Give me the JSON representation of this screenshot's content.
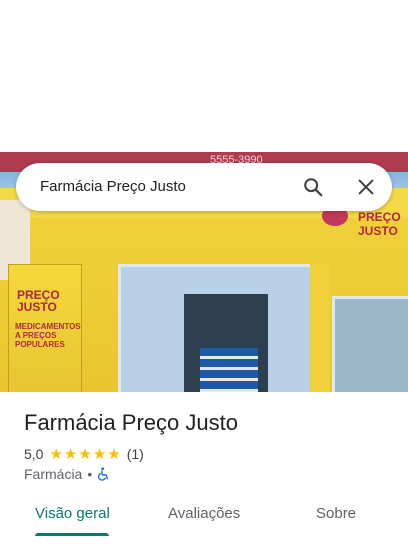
{
  "search": {
    "query": "Farmácia Preço Justo"
  },
  "photo": {
    "roof_text": "5555-3990",
    "left_sign_brand": "PREÇO JUSTO",
    "left_sign_sub": "MEDICAMENTOS A PREÇOS POPULARES",
    "right_sign_brand": "PREÇO JUSTO"
  },
  "place": {
    "title": "Farmácia Preço Justo",
    "rating": "5,0",
    "stars": 5,
    "review_count": "(1)",
    "category": "Farmácia",
    "separator": "•"
  },
  "tabs": [
    {
      "label": "Visão geral",
      "active": true
    },
    {
      "label": "Avaliações",
      "active": false
    },
    {
      "label": "Sobre",
      "active": false
    }
  ],
  "colors": {
    "accent": "#087a6d",
    "star": "#fbbc04",
    "accessibility_icon": "#1a73e8"
  },
  "icons": {
    "search": "search-icon",
    "close": "close-icon",
    "accessibility": "wheelchair-icon"
  }
}
